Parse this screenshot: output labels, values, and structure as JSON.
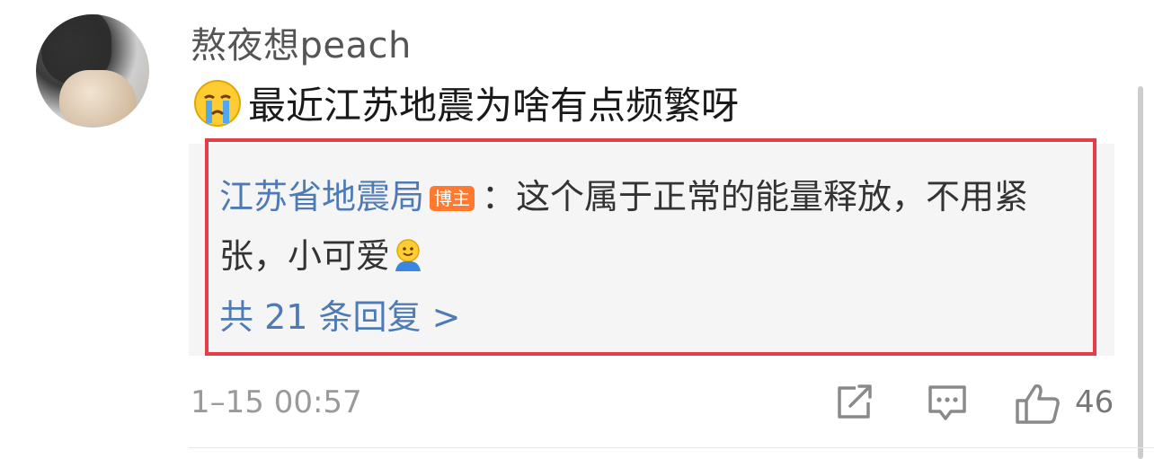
{
  "comment": {
    "username": "熬夜想peach",
    "avatar_icon": "avatar-photo",
    "emoji_icon": "crying-face-icon",
    "text": "最近江苏地震为啥有点频繁呀",
    "timestamp": "1–15 00:57",
    "like_count": "46"
  },
  "reply": {
    "author": "江苏省地震局",
    "badge": "博主",
    "separator": "：",
    "text_part1": "这个属于正常的能量释放，不用紧张，小可爱",
    "emoji_icon": "smiling-person-icon",
    "more_replies": "共 21 条回复 >"
  },
  "colors": {
    "link_blue": "#4f7bb5",
    "badge_orange": "#ff7a2f",
    "highlight_red": "#e53d48",
    "reply_bg": "#f5f5f5"
  },
  "actions": {
    "share_icon": "share-icon",
    "comment_icon": "comment-icon",
    "like_icon": "thumbs-up-icon"
  }
}
